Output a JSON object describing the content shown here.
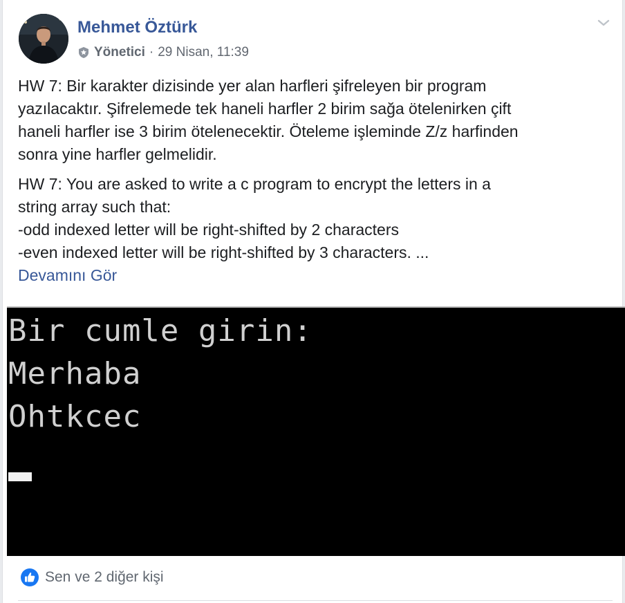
{
  "post": {
    "author": "Mehmet Öztürk",
    "role": "Yönetici",
    "separator": "·",
    "timestamp": "29 Nisan, 11:39",
    "paragraph_tr": [
      "HW 7: Bir karakter dizisinde yer alan harfleri şifreleyen bir program",
      "yazılacaktır. Şifrelemede tek haneli harfler 2 birim sağa ötelenirken çift",
      "haneli harfler ise 3 birim ötelenecektir. Öteleme işleminde Z/z harfinden",
      "sonra yine harfler gelmelidir."
    ],
    "paragraph_en": [
      "HW 7: You are asked to write a c program to encrypt the letters in a",
      "string array such that:",
      "-odd indexed letter will be right-shifted by 2 characters",
      "-even indexed letter will be right-shifted by 3 characters. ..."
    ],
    "see_more": "Devamını Gör"
  },
  "console": {
    "lines": [
      "Bir cumle girin:",
      "Merhaba",
      "Ohtkcec"
    ]
  },
  "reactions": {
    "icon": "thumbs-up-icon",
    "text": "Sen ve 2 diğer kişi"
  },
  "colors": {
    "link": "#385898",
    "meta": "#616770",
    "text": "#1c1e21",
    "like_blue": "#1877f2"
  }
}
